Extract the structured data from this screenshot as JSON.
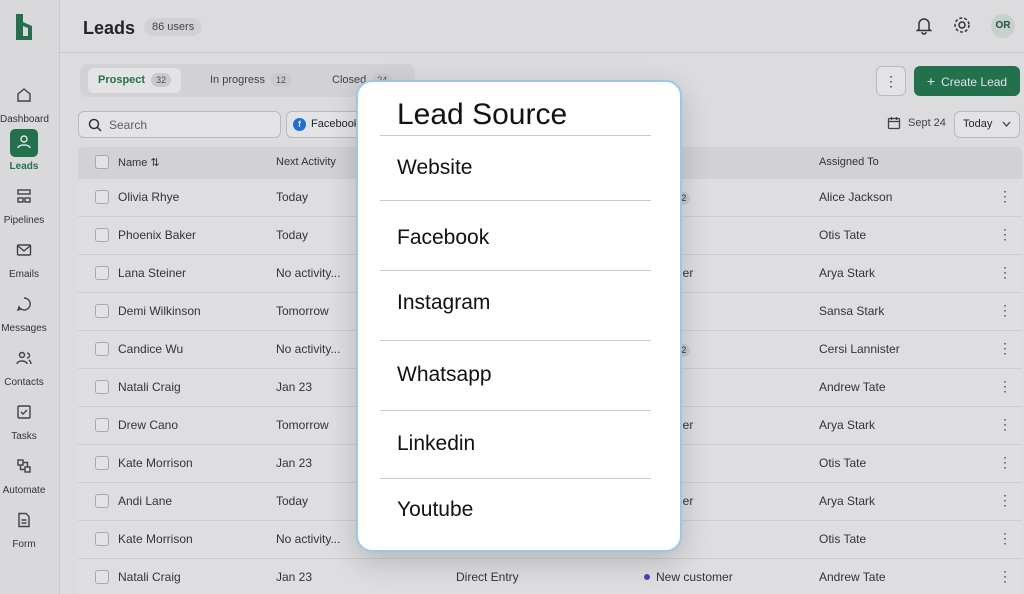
{
  "sidebar": {
    "items": [
      {
        "label": "Dashboard",
        "icon": "home-icon"
      },
      {
        "label": "Leads",
        "icon": "user-icon"
      },
      {
        "label": "Pipelines",
        "icon": "pipeline-icon"
      },
      {
        "label": "Emails",
        "icon": "mail-icon"
      },
      {
        "label": "Messages",
        "icon": "message-icon"
      },
      {
        "label": "Contacts",
        "icon": "contacts-icon"
      },
      {
        "label": "Tasks",
        "icon": "tasks-icon"
      },
      {
        "label": "Automate",
        "icon": "automate-icon"
      },
      {
        "label": "Form",
        "icon": "form-icon"
      }
    ],
    "active": "Leads"
  },
  "header": {
    "title": "Leads",
    "count": "86 users",
    "avatar": "OR"
  },
  "tabs": [
    {
      "label": "Prospect",
      "count": "32"
    },
    {
      "label": "In progress",
      "count": "12"
    },
    {
      "label": "Closed",
      "count": "24"
    }
  ],
  "toolbar": {
    "create_label": "Create Lead",
    "more": "⋮"
  },
  "search": {
    "placeholder": "Search"
  },
  "filter": {
    "chip": "Facebook"
  },
  "date": {
    "label": "Sept 24",
    "select": "Today"
  },
  "table": {
    "headers": {
      "name": "Name",
      "next": "Next Activity",
      "assigned": "Assigned To"
    },
    "rows": [
      {
        "name": "Olivia Rhye",
        "next": "Today",
        "source": "",
        "status": "rtant",
        "plus": "+2",
        "assigned": "Alice Jackson"
      },
      {
        "name": "Phoenix Baker",
        "next": "Today",
        "source": "",
        "status": "",
        "plus": "",
        "assigned": "Otis Tate"
      },
      {
        "name": "Lana Steiner",
        "next": "No activity...",
        "source": "",
        "status": "customer",
        "plus": "",
        "assigned": "Arya Stark"
      },
      {
        "name": "Demi Wilkinson",
        "next": "Tomorrow",
        "source": "",
        "status": "",
        "plus": "",
        "assigned": "Sansa Stark"
      },
      {
        "name": "Candice Wu",
        "next": "No activity...",
        "source": "",
        "status": "rtant",
        "plus": "+2",
        "assigned": "Cersi Lannister"
      },
      {
        "name": "Natali Craig",
        "next": "Jan 23",
        "source": "",
        "status": "",
        "plus": "",
        "assigned": "Andrew Tate"
      },
      {
        "name": "Drew Cano",
        "next": "Tomorrow",
        "source": "",
        "status": "customer",
        "plus": "",
        "assigned": "Arya Stark"
      },
      {
        "name": "Kate Morrison",
        "next": "Jan 23",
        "source": "",
        "status": "",
        "plus": "",
        "assigned": "Otis Tate"
      },
      {
        "name": "Andi Lane",
        "next": "Today",
        "source": "",
        "status": "customer",
        "plus": "",
        "assigned": "Arya Stark"
      },
      {
        "name": "Kate Morrison",
        "next": "No activity...",
        "source": "",
        "status": "",
        "plus": "",
        "assigned": "Otis Tate"
      },
      {
        "name": "Natali Craig",
        "next": "Jan 23",
        "source": "Direct Entry",
        "status": "New customer",
        "plus": "",
        "assigned": "Andrew Tate"
      }
    ]
  },
  "modal": {
    "title": "Lead Source",
    "options": [
      "Website",
      "Facebook",
      "Instagram",
      "Whatsapp",
      "Linkedin",
      "Youtube"
    ]
  },
  "colors": {
    "accent": "#1f7a4d",
    "status_dot": "#5b3fd0",
    "facebook": "#1877f2"
  }
}
